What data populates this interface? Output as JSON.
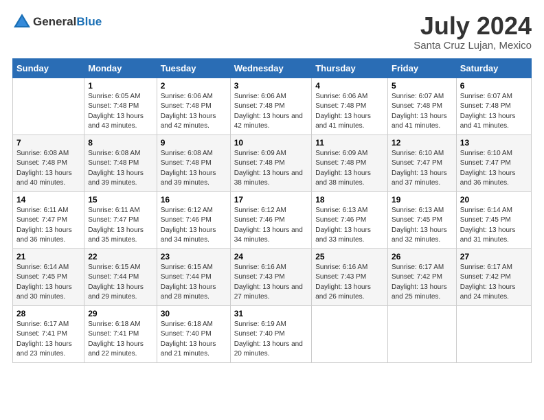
{
  "logo": {
    "general": "General",
    "blue": "Blue"
  },
  "title": "July 2024",
  "subtitle": "Santa Cruz Lujan, Mexico",
  "days_of_week": [
    "Sunday",
    "Monday",
    "Tuesday",
    "Wednesday",
    "Thursday",
    "Friday",
    "Saturday"
  ],
  "weeks": [
    [
      {
        "day": "",
        "sunrise": "",
        "sunset": "",
        "daylight": ""
      },
      {
        "day": "1",
        "sunrise": "Sunrise: 6:05 AM",
        "sunset": "Sunset: 7:48 PM",
        "daylight": "Daylight: 13 hours and 43 minutes."
      },
      {
        "day": "2",
        "sunrise": "Sunrise: 6:06 AM",
        "sunset": "Sunset: 7:48 PM",
        "daylight": "Daylight: 13 hours and 42 minutes."
      },
      {
        "day": "3",
        "sunrise": "Sunrise: 6:06 AM",
        "sunset": "Sunset: 7:48 PM",
        "daylight": "Daylight: 13 hours and 42 minutes."
      },
      {
        "day": "4",
        "sunrise": "Sunrise: 6:06 AM",
        "sunset": "Sunset: 7:48 PM",
        "daylight": "Daylight: 13 hours and 41 minutes."
      },
      {
        "day": "5",
        "sunrise": "Sunrise: 6:07 AM",
        "sunset": "Sunset: 7:48 PM",
        "daylight": "Daylight: 13 hours and 41 minutes."
      },
      {
        "day": "6",
        "sunrise": "Sunrise: 6:07 AM",
        "sunset": "Sunset: 7:48 PM",
        "daylight": "Daylight: 13 hours and 41 minutes."
      }
    ],
    [
      {
        "day": "7",
        "sunrise": "Sunrise: 6:08 AM",
        "sunset": "Sunset: 7:48 PM",
        "daylight": "Daylight: 13 hours and 40 minutes."
      },
      {
        "day": "8",
        "sunrise": "Sunrise: 6:08 AM",
        "sunset": "Sunset: 7:48 PM",
        "daylight": "Daylight: 13 hours and 39 minutes."
      },
      {
        "day": "9",
        "sunrise": "Sunrise: 6:08 AM",
        "sunset": "Sunset: 7:48 PM",
        "daylight": "Daylight: 13 hours and 39 minutes."
      },
      {
        "day": "10",
        "sunrise": "Sunrise: 6:09 AM",
        "sunset": "Sunset: 7:48 PM",
        "daylight": "Daylight: 13 hours and 38 minutes."
      },
      {
        "day": "11",
        "sunrise": "Sunrise: 6:09 AM",
        "sunset": "Sunset: 7:48 PM",
        "daylight": "Daylight: 13 hours and 38 minutes."
      },
      {
        "day": "12",
        "sunrise": "Sunrise: 6:10 AM",
        "sunset": "Sunset: 7:47 PM",
        "daylight": "Daylight: 13 hours and 37 minutes."
      },
      {
        "day": "13",
        "sunrise": "Sunrise: 6:10 AM",
        "sunset": "Sunset: 7:47 PM",
        "daylight": "Daylight: 13 hours and 36 minutes."
      }
    ],
    [
      {
        "day": "14",
        "sunrise": "Sunrise: 6:11 AM",
        "sunset": "Sunset: 7:47 PM",
        "daylight": "Daylight: 13 hours and 36 minutes."
      },
      {
        "day": "15",
        "sunrise": "Sunrise: 6:11 AM",
        "sunset": "Sunset: 7:47 PM",
        "daylight": "Daylight: 13 hours and 35 minutes."
      },
      {
        "day": "16",
        "sunrise": "Sunrise: 6:12 AM",
        "sunset": "Sunset: 7:46 PM",
        "daylight": "Daylight: 13 hours and 34 minutes."
      },
      {
        "day": "17",
        "sunrise": "Sunrise: 6:12 AM",
        "sunset": "Sunset: 7:46 PM",
        "daylight": "Daylight: 13 hours and 34 minutes."
      },
      {
        "day": "18",
        "sunrise": "Sunrise: 6:13 AM",
        "sunset": "Sunset: 7:46 PM",
        "daylight": "Daylight: 13 hours and 33 minutes."
      },
      {
        "day": "19",
        "sunrise": "Sunrise: 6:13 AM",
        "sunset": "Sunset: 7:45 PM",
        "daylight": "Daylight: 13 hours and 32 minutes."
      },
      {
        "day": "20",
        "sunrise": "Sunrise: 6:14 AM",
        "sunset": "Sunset: 7:45 PM",
        "daylight": "Daylight: 13 hours and 31 minutes."
      }
    ],
    [
      {
        "day": "21",
        "sunrise": "Sunrise: 6:14 AM",
        "sunset": "Sunset: 7:45 PM",
        "daylight": "Daylight: 13 hours and 30 minutes."
      },
      {
        "day": "22",
        "sunrise": "Sunrise: 6:15 AM",
        "sunset": "Sunset: 7:44 PM",
        "daylight": "Daylight: 13 hours and 29 minutes."
      },
      {
        "day": "23",
        "sunrise": "Sunrise: 6:15 AM",
        "sunset": "Sunset: 7:44 PM",
        "daylight": "Daylight: 13 hours and 28 minutes."
      },
      {
        "day": "24",
        "sunrise": "Sunrise: 6:16 AM",
        "sunset": "Sunset: 7:43 PM",
        "daylight": "Daylight: 13 hours and 27 minutes."
      },
      {
        "day": "25",
        "sunrise": "Sunrise: 6:16 AM",
        "sunset": "Sunset: 7:43 PM",
        "daylight": "Daylight: 13 hours and 26 minutes."
      },
      {
        "day": "26",
        "sunrise": "Sunrise: 6:17 AM",
        "sunset": "Sunset: 7:42 PM",
        "daylight": "Daylight: 13 hours and 25 minutes."
      },
      {
        "day": "27",
        "sunrise": "Sunrise: 6:17 AM",
        "sunset": "Sunset: 7:42 PM",
        "daylight": "Daylight: 13 hours and 24 minutes."
      }
    ],
    [
      {
        "day": "28",
        "sunrise": "Sunrise: 6:17 AM",
        "sunset": "Sunset: 7:41 PM",
        "daylight": "Daylight: 13 hours and 23 minutes."
      },
      {
        "day": "29",
        "sunrise": "Sunrise: 6:18 AM",
        "sunset": "Sunset: 7:41 PM",
        "daylight": "Daylight: 13 hours and 22 minutes."
      },
      {
        "day": "30",
        "sunrise": "Sunrise: 6:18 AM",
        "sunset": "Sunset: 7:40 PM",
        "daylight": "Daylight: 13 hours and 21 minutes."
      },
      {
        "day": "31",
        "sunrise": "Sunrise: 6:19 AM",
        "sunset": "Sunset: 7:40 PM",
        "daylight": "Daylight: 13 hours and 20 minutes."
      },
      {
        "day": "",
        "sunrise": "",
        "sunset": "",
        "daylight": ""
      },
      {
        "day": "",
        "sunrise": "",
        "sunset": "",
        "daylight": ""
      },
      {
        "day": "",
        "sunrise": "",
        "sunset": "",
        "daylight": ""
      }
    ]
  ]
}
